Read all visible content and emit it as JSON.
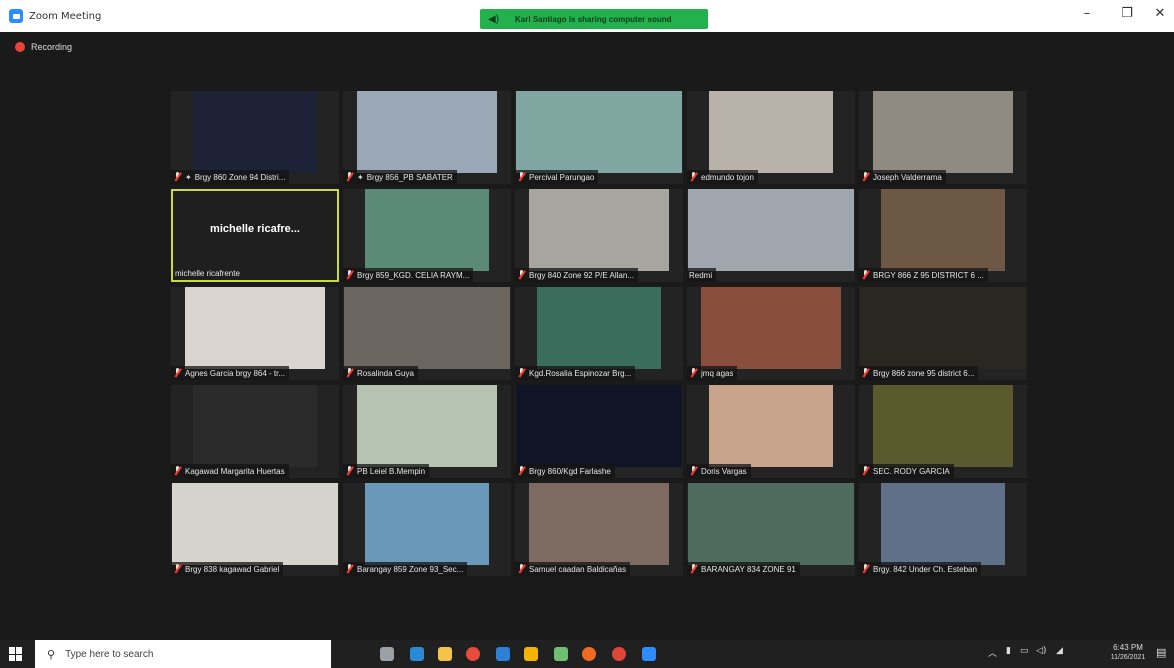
{
  "window": {
    "title": "Zoom Meeting",
    "sharing_banner": "Karl Santiago is sharing computer sound",
    "controls": {
      "minimize": "–",
      "restore": "❐",
      "close": "✕"
    }
  },
  "meeting": {
    "recording_label": "Recording",
    "active_speaker_display": "michelle ricafre...",
    "tiles": [
      {
        "name": "Brgy 860 Zone 94 Distri...",
        "muted": true,
        "pinned": true,
        "bg": "#1d2236"
      },
      {
        "name": "Brgy 856_PB SABATER",
        "muted": true,
        "pinned": true,
        "bg": "#9aa8b5"
      },
      {
        "name": "Percival Parungao",
        "muted": true,
        "pinned": false,
        "bg": "#7fa6a0"
      },
      {
        "name": "edmundo tojon",
        "muted": true,
        "pinned": false,
        "bg": "#b9b2ab"
      },
      {
        "name": "Joseph Valderrama",
        "muted": true,
        "pinned": false,
        "bg": "#8f8a82"
      },
      {
        "name": "michelle ricafrente",
        "muted": false,
        "pinned": false,
        "bg": "#1f1f1f",
        "active": true
      },
      {
        "name": "Brgy 859_KGD. CELIA RAYM...",
        "muted": true,
        "pinned": false,
        "bg": "#5c8a78"
      },
      {
        "name": "Brgy 840 Zone 92 P/E Allan...",
        "muted": true,
        "pinned": false,
        "bg": "#a8a4a0"
      },
      {
        "name": "Redmi",
        "muted": false,
        "pinned": false,
        "bg": "#9fa6ad"
      },
      {
        "name": "BRGY 866 Z 95 DISTRICT 6 ...",
        "muted": true,
        "pinned": false,
        "bg": "#6d5846"
      },
      {
        "name": "Agnes Garcia brgy 864 - tr...",
        "muted": true,
        "pinned": false,
        "bg": "#d9d4cf"
      },
      {
        "name": "Rosalinda Guya",
        "muted": true,
        "pinned": false,
        "bg": "#6b6560"
      },
      {
        "name": "Kgd.Rosalia Espinozar Brg...",
        "muted": true,
        "pinned": false,
        "bg": "#3b6d5c"
      },
      {
        "name": "jmq agas",
        "muted": true,
        "pinned": false,
        "bg": "#8a4f3c"
      },
      {
        "name": "Brgy 866 zone 95 district 6...",
        "muted": true,
        "pinned": false,
        "bg": "#2a2620"
      },
      {
        "name": "Kagawad Margarita Huertas",
        "muted": true,
        "pinned": false,
        "bg": "#2b2b2b"
      },
      {
        "name": "PB Leiel B.Mempin",
        "muted": true,
        "pinned": false,
        "bg": "#b5c3b0"
      },
      {
        "name": "Brgy 860/Kgd Farlashe",
        "muted": true,
        "pinned": false,
        "bg": "#101426"
      },
      {
        "name": "Doris Vargas",
        "muted": true,
        "pinned": false,
        "bg": "#c9a48c"
      },
      {
        "name": "SEC. RODY GARCIA",
        "muted": true,
        "pinned": false,
        "bg": "#5a5a2e"
      },
      {
        "name": "Brgy 838 kagawad Gabriel",
        "muted": true,
        "pinned": false,
        "bg": "#d6d2cc"
      },
      {
        "name": "Barangay 859 Zone 93_Sec...",
        "muted": true,
        "pinned": false,
        "bg": "#6a98b8"
      },
      {
        "name": "Samuel caadan Baldicañas",
        "muted": true,
        "pinned": false,
        "bg": "#7d6b62"
      },
      {
        "name": "BARANGAY 834 ZONE 91",
        "muted": true,
        "pinned": false,
        "bg": "#4f6b5e"
      },
      {
        "name": "Brgy. 842 Under Ch. Esteban",
        "muted": true,
        "pinned": false,
        "bg": "#5f7088"
      }
    ]
  },
  "taskbar": {
    "search_placeholder": "Type here to search",
    "time": "6:43 PM",
    "date": "11/26/2021",
    "apps": [
      {
        "icon": "task-view-icon",
        "color": "#9aa0a6"
      },
      {
        "icon": "edge-icon",
        "color": "#2a8ad4"
      },
      {
        "icon": "file-explorer-icon",
        "color": "#f2c447"
      },
      {
        "icon": "chrome-icon",
        "color": "#e84b3c"
      },
      {
        "icon": "outlook-icon",
        "color": "#2f7fd4"
      },
      {
        "icon": "files-icon",
        "color": "#f5b400"
      },
      {
        "icon": "snip-icon",
        "color": "#6fbf73"
      },
      {
        "icon": "firefox-icon",
        "color": "#f06a22"
      },
      {
        "icon": "chrome-alt-icon",
        "color": "#e0453a"
      },
      {
        "icon": "zoom-icon",
        "color": "#2d8cff"
      }
    ]
  }
}
